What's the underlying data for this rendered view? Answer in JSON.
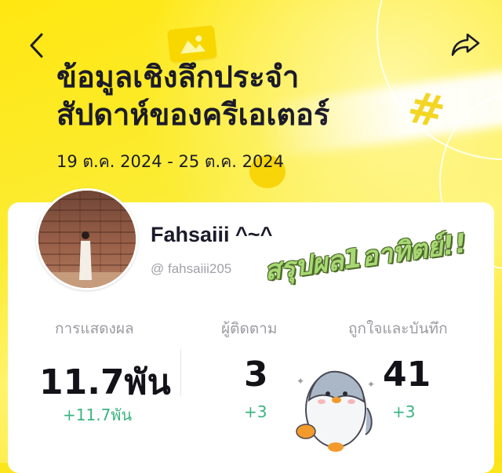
{
  "header": {
    "title_line1": "ข้อมูลเชิงลึกประจำ",
    "title_line2": "สัปดาห์ของครีเอเตอร์",
    "date_range": "19 ต.ค. 2024 - 25 ต.ค. 2024"
  },
  "profile": {
    "name": "Fahsaiii ^~^",
    "handle": "@ fahsaiii205",
    "sticker_text": "สรุปผล1อาทิตย์!!"
  },
  "stats": [
    {
      "label": "การแสดงผล",
      "value": "11.7พัน",
      "delta": "+11.7พัน"
    },
    {
      "label": "ผู้ติดตาม",
      "value": "3",
      "delta": "+3"
    },
    {
      "label": "ถูกใจและบันทึก",
      "value": "41",
      "delta": "+3"
    }
  ],
  "icons": {
    "back": "chevron-left-icon",
    "share": "share-arrow-icon"
  },
  "colors": {
    "background": "#fbe61c",
    "delta": "#3cb480",
    "text": "#1b1b2b"
  }
}
